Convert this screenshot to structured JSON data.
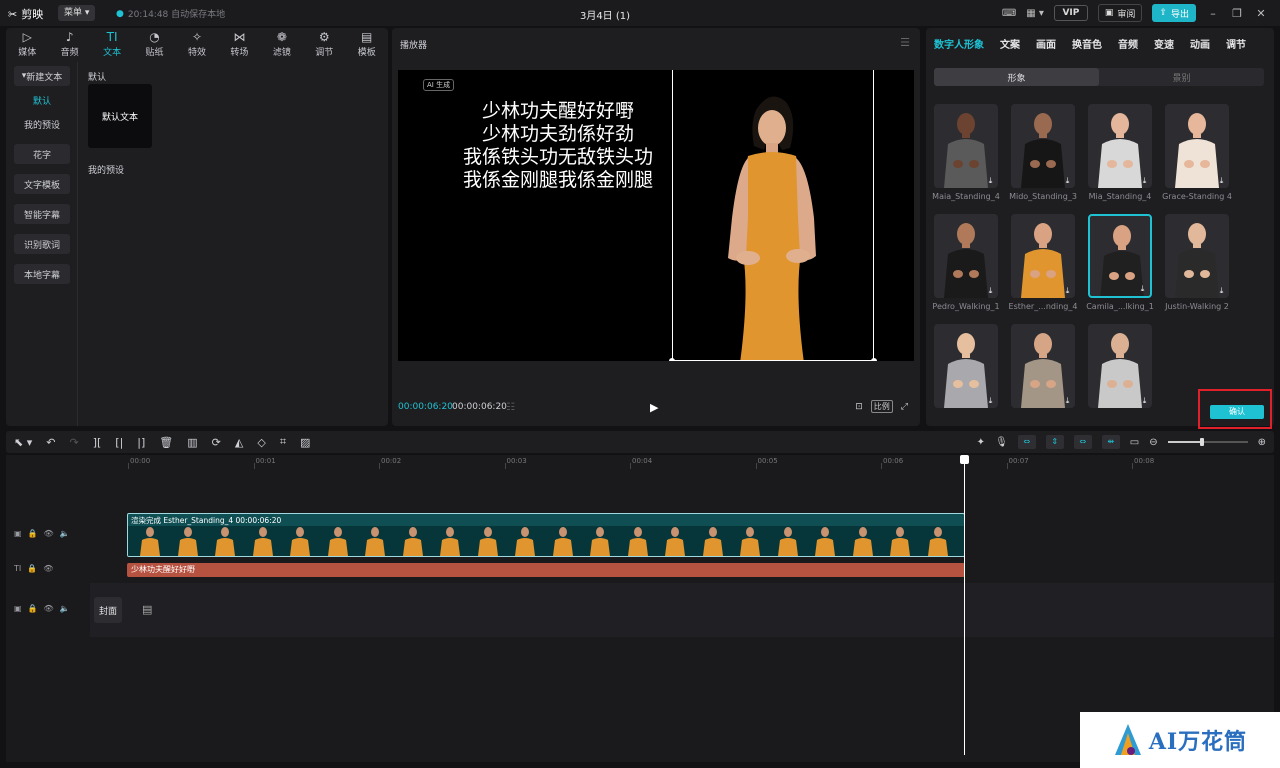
{
  "app": {
    "name": "剪映",
    "menu_label": "菜单",
    "autosave_text": "20:14:48 自动保存本地",
    "project_title": "3月4日 (1)",
    "vip_label": "VIP",
    "review_label": "审阅",
    "export_label": "导出"
  },
  "media_tabs": [
    {
      "label": "媒体",
      "icon": "media-icon"
    },
    {
      "label": "音频",
      "icon": "audio-icon"
    },
    {
      "label": "文本",
      "icon": "text-icon",
      "active": true
    },
    {
      "label": "贴纸",
      "icon": "sticker-icon"
    },
    {
      "label": "特效",
      "icon": "effects-icon"
    },
    {
      "label": "转场",
      "icon": "transition-icon"
    },
    {
      "label": "滤镜",
      "icon": "filter-icon"
    },
    {
      "label": "调节",
      "icon": "adjust-icon"
    },
    {
      "label": "模板",
      "icon": "template-icon"
    }
  ],
  "text_sidebar": {
    "new_text": "新建文本",
    "default": "默认",
    "my_presets": "我的预设",
    "items": [
      "花字",
      "文字模板",
      "智能字幕",
      "识别歌词",
      "本地字幕"
    ]
  },
  "text_content": {
    "section_default": "默认",
    "default_tile": "默认文本",
    "section_presets": "我的预设"
  },
  "player": {
    "title": "播放器",
    "ai_badge": "AI 生成",
    "lyrics": [
      "少林功夫醒好好嘢",
      "少林功夫劲係好劲",
      "我係铁头功无敌铁头功",
      "我係金刚腿我係金刚腿"
    ],
    "current_time": "00:00:06:20",
    "total_time": "00:00:06:20",
    "ratio_label": "比例"
  },
  "right_panel": {
    "tabs": [
      {
        "label": "数字人形象",
        "active": true
      },
      {
        "label": "文案"
      },
      {
        "label": "画面"
      },
      {
        "label": "换音色"
      },
      {
        "label": "音频"
      },
      {
        "label": "变速"
      },
      {
        "label": "动画"
      },
      {
        "label": "调节"
      }
    ],
    "seg_tabs": [
      {
        "label": "形象",
        "active": true
      },
      {
        "label": "景别"
      }
    ],
    "avatars": [
      {
        "name": "Maia_Standing_4",
        "outfit": "#5a5a5a",
        "skin": "#6b4330"
      },
      {
        "name": "Mido_Standing_3",
        "outfit": "#161616",
        "skin": "#9a6a50"
      },
      {
        "name": "Mia_Standing_4",
        "outfit": "#d8d8d8",
        "skin": "#e4b79c"
      },
      {
        "name": "Grace-Standing 4",
        "outfit": "#efe2d6",
        "skin": "#e6b79a"
      },
      {
        "name": "Pedro_Walking_1",
        "outfit": "#1a1a1a",
        "skin": "#b07a5a"
      },
      {
        "name": "Esther_...nding_4",
        "outfit": "#e0952e",
        "skin": "#d9a283"
      },
      {
        "name": "Camila_...lking_1",
        "outfit": "#202020",
        "skin": "#d8a283",
        "selected": true
      },
      {
        "name": "Justin-Walking 2",
        "outfit": "#2a2a2a",
        "skin": "#e2b89a"
      },
      {
        "name": "",
        "outfit": "#a9a9ad",
        "skin": "#e5bf9e"
      },
      {
        "name": "",
        "outfit": "#a39686",
        "skin": "#d6a585"
      },
      {
        "name": "",
        "outfit": "#c9c9c9",
        "skin": "#dcb093"
      }
    ],
    "confirm_label": "确认"
  },
  "timeline": {
    "ticks": [
      "00:00",
      "00:01",
      "00:02",
      "00:03",
      "00:04",
      "00:05",
      "00:06",
      "00:07",
      "00:08"
    ],
    "main_clip_label": "渲染完成   Esther_Standing_4   00:00:06:20",
    "text_clip_label": "少林功夫醒好好嘢",
    "cover_label": "封面"
  },
  "colors": {
    "accent": "#1fc2d3",
    "highlight_frame": "#e0202a",
    "text_clip": "#b65240",
    "video_clip": "#0f4f54"
  },
  "watermark": "AI万花筒"
}
